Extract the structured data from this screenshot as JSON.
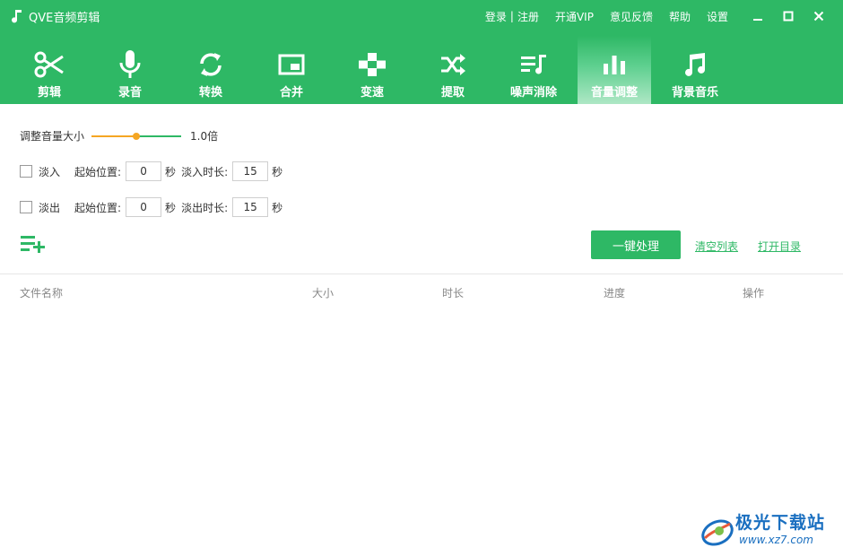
{
  "app": {
    "title": "QVE音频剪辑"
  },
  "top_links": {
    "login": "登录",
    "separator": "|",
    "register": "注册",
    "vip": "开通VIP",
    "feedback": "意见反馈",
    "help": "帮助",
    "settings": "设置"
  },
  "nav": {
    "items": [
      {
        "label": "剪辑",
        "icon": "scissors-icon"
      },
      {
        "label": "录音",
        "icon": "microphone-icon"
      },
      {
        "label": "转换",
        "icon": "sync-icon"
      },
      {
        "label": "合并",
        "icon": "picture-in-picture-icon"
      },
      {
        "label": "变速",
        "icon": "gamepad-icon"
      },
      {
        "label": "提取",
        "icon": "shuffle-icon"
      },
      {
        "label": "噪声消除",
        "icon": "playlist-music-icon"
      },
      {
        "label": "音量调整",
        "icon": "bar-chart-icon",
        "active": true
      },
      {
        "label": "背景音乐",
        "icon": "music-note-icon"
      }
    ]
  },
  "volume": {
    "label": "调整音量大小",
    "value_text": "1.0倍",
    "slider_fraction": 0.5
  },
  "fade_in": {
    "label": "淡入",
    "checked": false,
    "start_label": "起始位置:",
    "start_value": "0",
    "start_unit": "秒",
    "duration_label": "淡入时长:",
    "duration_value": "15",
    "duration_unit": "秒"
  },
  "fade_out": {
    "label": "淡出",
    "checked": false,
    "start_label": "起始位置:",
    "start_value": "0",
    "start_unit": "秒",
    "duration_label": "淡出时长:",
    "duration_value": "15",
    "duration_unit": "秒"
  },
  "actions": {
    "process": "一键处理",
    "clear_list": "清空列表",
    "open_dir": "打开目录"
  },
  "table": {
    "columns": [
      "文件名称",
      "大小",
      "时长",
      "进度",
      "操作"
    ]
  },
  "watermark": {
    "title": "极光下载站",
    "url": "www.xz7.com"
  },
  "colors": {
    "brand": "#2eb865",
    "slider_left": "#f5a623",
    "watermark": "#1a6fc0"
  }
}
